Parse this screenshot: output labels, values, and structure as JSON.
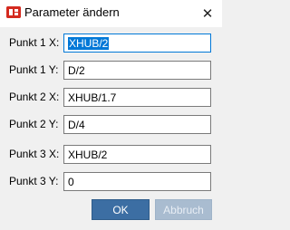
{
  "window": {
    "title": "Parameter ändern",
    "close_glyph": "✕",
    "app_icon": "app-logo-icon",
    "accent_color": "#0078d7"
  },
  "fields": [
    {
      "label": "Punkt 1 X:",
      "value": "XHUB/2",
      "selected": true
    },
    {
      "label": "Punkt 1 Y:",
      "value": "D/2"
    },
    {
      "label": "Punkt 2 X:",
      "value": "XHUB/1.7"
    },
    {
      "label": "Punkt 2 Y:",
      "value": "D/4"
    },
    {
      "label": "Punkt 3 X:",
      "value": "XHUB/2"
    },
    {
      "label": "Punkt 3 Y:",
      "value": "0"
    }
  ],
  "buttons": {
    "ok_label": "OK",
    "cancel_label": "Abbruch",
    "ok_color": "#3c6ea3",
    "cancel_color": "#a9bcd0"
  }
}
